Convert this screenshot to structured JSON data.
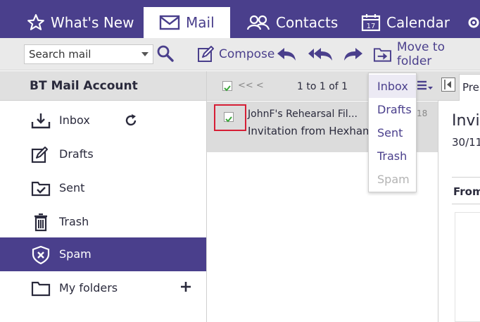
{
  "nav": {
    "tabs": [
      {
        "label": "What's New",
        "icon": "star-icon"
      },
      {
        "label": "Mail",
        "icon": "envelope-icon",
        "active": true
      },
      {
        "label": "Contacts",
        "icon": "contacts-icon"
      },
      {
        "label": "Calendar",
        "icon": "calendar-icon",
        "day": "17"
      }
    ]
  },
  "toolbar": {
    "search_placeholder": "Search mail",
    "compose_label": "Compose",
    "move_label": "Move to folder"
  },
  "sidebar": {
    "title": "BT Mail Account",
    "folders": [
      {
        "label": "Inbox",
        "icon": "inbox-icon"
      },
      {
        "label": "Drafts",
        "icon": "drafts-icon"
      },
      {
        "label": "Sent",
        "icon": "sent-icon"
      },
      {
        "label": "Trash",
        "icon": "trash-icon"
      },
      {
        "label": "Spam",
        "icon": "spam-icon",
        "selected": true
      },
      {
        "label": "My folders",
        "icon": "folder-icon"
      }
    ]
  },
  "message_list": {
    "pager_prev": "<< <",
    "count": "1 to 1 of 1",
    "messages": [
      {
        "from": "JohnF's Rehearsal Fil...",
        "subject": "Invitation from Hexham",
        "date": "18",
        "checked": true
      }
    ]
  },
  "move_menu": {
    "items": [
      {
        "label": "Inbox",
        "state": "highlight"
      },
      {
        "label": "Drafts",
        "state": "normal"
      },
      {
        "label": "Sent",
        "state": "normal"
      },
      {
        "label": "Trash",
        "state": "normal"
      },
      {
        "label": "Spam",
        "state": "disabled"
      }
    ]
  },
  "reading_pane": {
    "tab_label": "Pre",
    "subject": "Invi",
    "date": "30/11",
    "from_label": "From"
  },
  "colors": {
    "brand": "#4a3f8c",
    "check": "#3aa63a",
    "highlight_border": "#d61e35"
  }
}
